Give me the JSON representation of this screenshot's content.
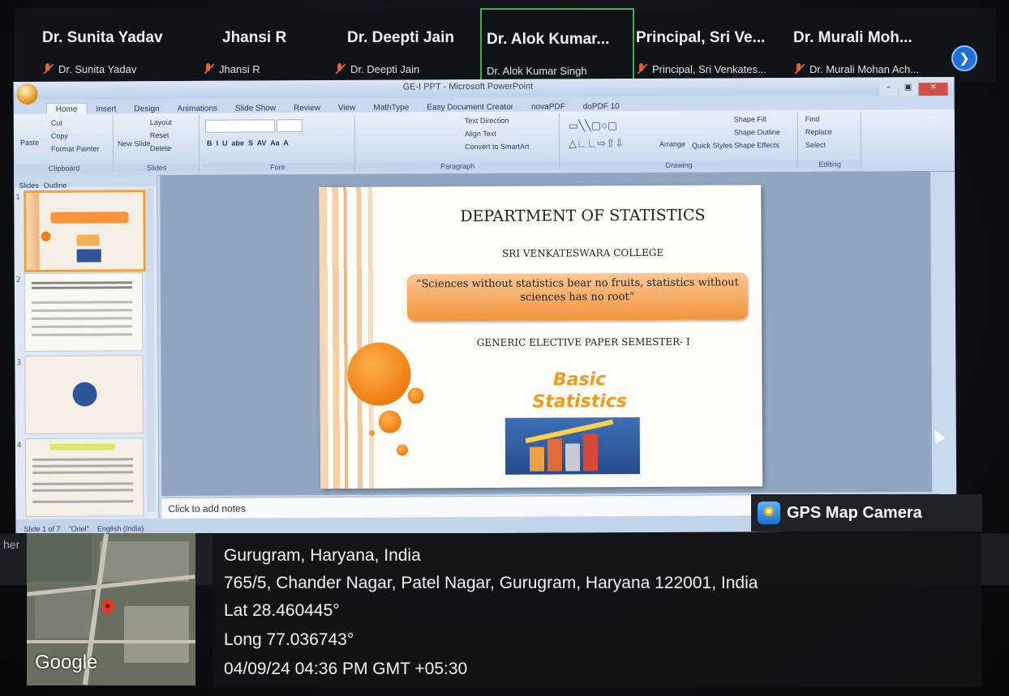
{
  "participants": [
    {
      "display": "Dr. Sunita Yadav",
      "name_label": "Dr. Sunita Yadav",
      "muted": true
    },
    {
      "display": "Jhansi R",
      "name_label": "Jhansi R",
      "muted": true
    },
    {
      "display": "Dr. Deepti Jain",
      "name_label": "Dr. Deepti Jain",
      "muted": true
    },
    {
      "display": "Dr. Alok Kumar...",
      "name_label": "Dr. Alok Kumar Singh",
      "muted": false,
      "active_speaker": true
    },
    {
      "display": "Principal, Sri Ve...",
      "name_label": "Principal, Sri Venkates...",
      "muted": true
    },
    {
      "display": "Dr. Murali Moh...",
      "name_label": "Dr. Murali Mohan Ach...",
      "muted": true
    }
  ],
  "next_icon": "chevron-right-icon",
  "ppt": {
    "window_title": "GE-I PPT - Microsoft PowerPoint",
    "tabs": [
      "Home",
      "Insert",
      "Design",
      "Animations",
      "Slide Show",
      "Review",
      "View",
      "MathType",
      "Easy Document Creator",
      "novaPDF",
      "doPDF 10"
    ],
    "ribbon": {
      "clipboard": {
        "label": "Clipboard",
        "paste": "Paste",
        "cut": "Cut",
        "copy": "Copy",
        "format_painter": "Format Painter"
      },
      "slides": {
        "label": "Slides",
        "new_slide": "New Slide",
        "layout": "Layout",
        "reset": "Reset",
        "delete": "Delete"
      },
      "font": {
        "label": "Font"
      },
      "paragraph": {
        "label": "Paragraph",
        "text_direction": "Text Direction",
        "align_text": "Align Text",
        "convert": "Convert to SmartArt"
      },
      "drawing": {
        "label": "Drawing",
        "arrange": "Arrange",
        "quick_styles": "Quick Styles",
        "shape_fill": "Shape Fill",
        "shape_outline": "Shape Outline",
        "shape_effects": "Shape Effects"
      },
      "editing": {
        "label": "Editing",
        "find": "Find",
        "replace": "Replace",
        "select": "Select"
      }
    },
    "panel_tabs": [
      "Slides",
      "Outline"
    ],
    "thumb_numbers": [
      "1",
      "2",
      "3",
      "4"
    ],
    "notes_placeholder": "Click to add notes",
    "status": [
      "Slide 1 of 7",
      "\"Oriel\"",
      "English (India)"
    ],
    "slide": {
      "title": "DEPARTMENT OF STATISTICS",
      "subtitle": "SRI VENKATESWARA COLLEGE",
      "quote": "“Sciences without statistics bear no fruits, statistics without sciences has no root”",
      "paper": "GENERIC ELECTIVE PAPER SEMESTER- I",
      "course_line1": "Basic",
      "course_line2": "Statistics"
    }
  },
  "taskbar": {
    "left_text": "her"
  },
  "gps": {
    "app_name": "GPS Map Camera",
    "map_brand": "Google",
    "place": "Gurugram, Haryana, India",
    "address": "765/5, Chander Nagar, Patel Nagar, Gurugram, Haryana 122001, India",
    "lat": "Lat 28.460445°",
    "long": "Long 77.036743°",
    "datetime": "04/09/24 04:36 PM GMT +05:30"
  }
}
